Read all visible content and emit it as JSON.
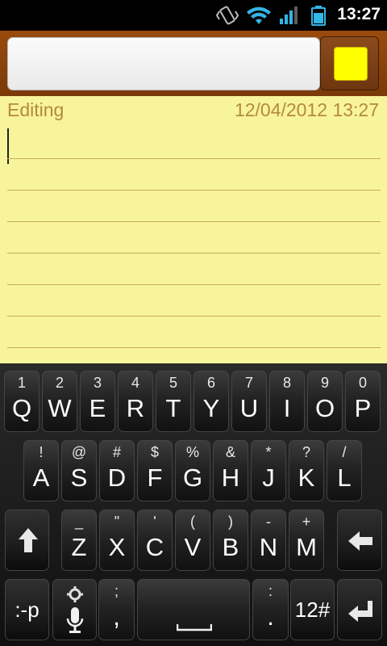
{
  "status_bar": {
    "time": "13:27",
    "icons": [
      "vibrate-icon",
      "wifi-icon",
      "signal-icon",
      "battery-icon"
    ]
  },
  "title_bar": {
    "title_value": "",
    "color_selected": "#ffff00"
  },
  "note": {
    "status": "Editing",
    "date": "12/04/2012 13:27",
    "body": "",
    "background": "#f8f49c"
  },
  "keyboard": {
    "row1": [
      {
        "hint": "1",
        "key": "Q"
      },
      {
        "hint": "2",
        "key": "W"
      },
      {
        "hint": "3",
        "key": "E"
      },
      {
        "hint": "4",
        "key": "R"
      },
      {
        "hint": "5",
        "key": "T"
      },
      {
        "hint": "6",
        "key": "Y"
      },
      {
        "hint": "7",
        "key": "U"
      },
      {
        "hint": "8",
        "key": "I"
      },
      {
        "hint": "9",
        "key": "O"
      },
      {
        "hint": "0",
        "key": "P"
      }
    ],
    "row2": [
      {
        "hint": "!",
        "key": "A"
      },
      {
        "hint": "@",
        "key": "S"
      },
      {
        "hint": "#",
        "key": "D"
      },
      {
        "hint": "$",
        "key": "F"
      },
      {
        "hint": "%",
        "key": "G"
      },
      {
        "hint": "&",
        "key": "H"
      },
      {
        "hint": "*",
        "key": "J"
      },
      {
        "hint": "?",
        "key": "K"
      },
      {
        "hint": "/",
        "key": "L"
      }
    ],
    "row3": [
      {
        "hint": "_",
        "key": "Z"
      },
      {
        "hint": "\"",
        "key": "X"
      },
      {
        "hint": "'",
        "key": "C"
      },
      {
        "hint": "(",
        "key": "V"
      },
      {
        "hint": ")",
        "key": "B"
      },
      {
        "hint": "-",
        "key": "N"
      },
      {
        "hint": "+",
        "key": "M"
      }
    ],
    "smiley_label": ":-p",
    "comma_hint": ";",
    "comma_key": ",",
    "period_hint": ":",
    "period_key": ".",
    "symbols_label": "12#"
  }
}
